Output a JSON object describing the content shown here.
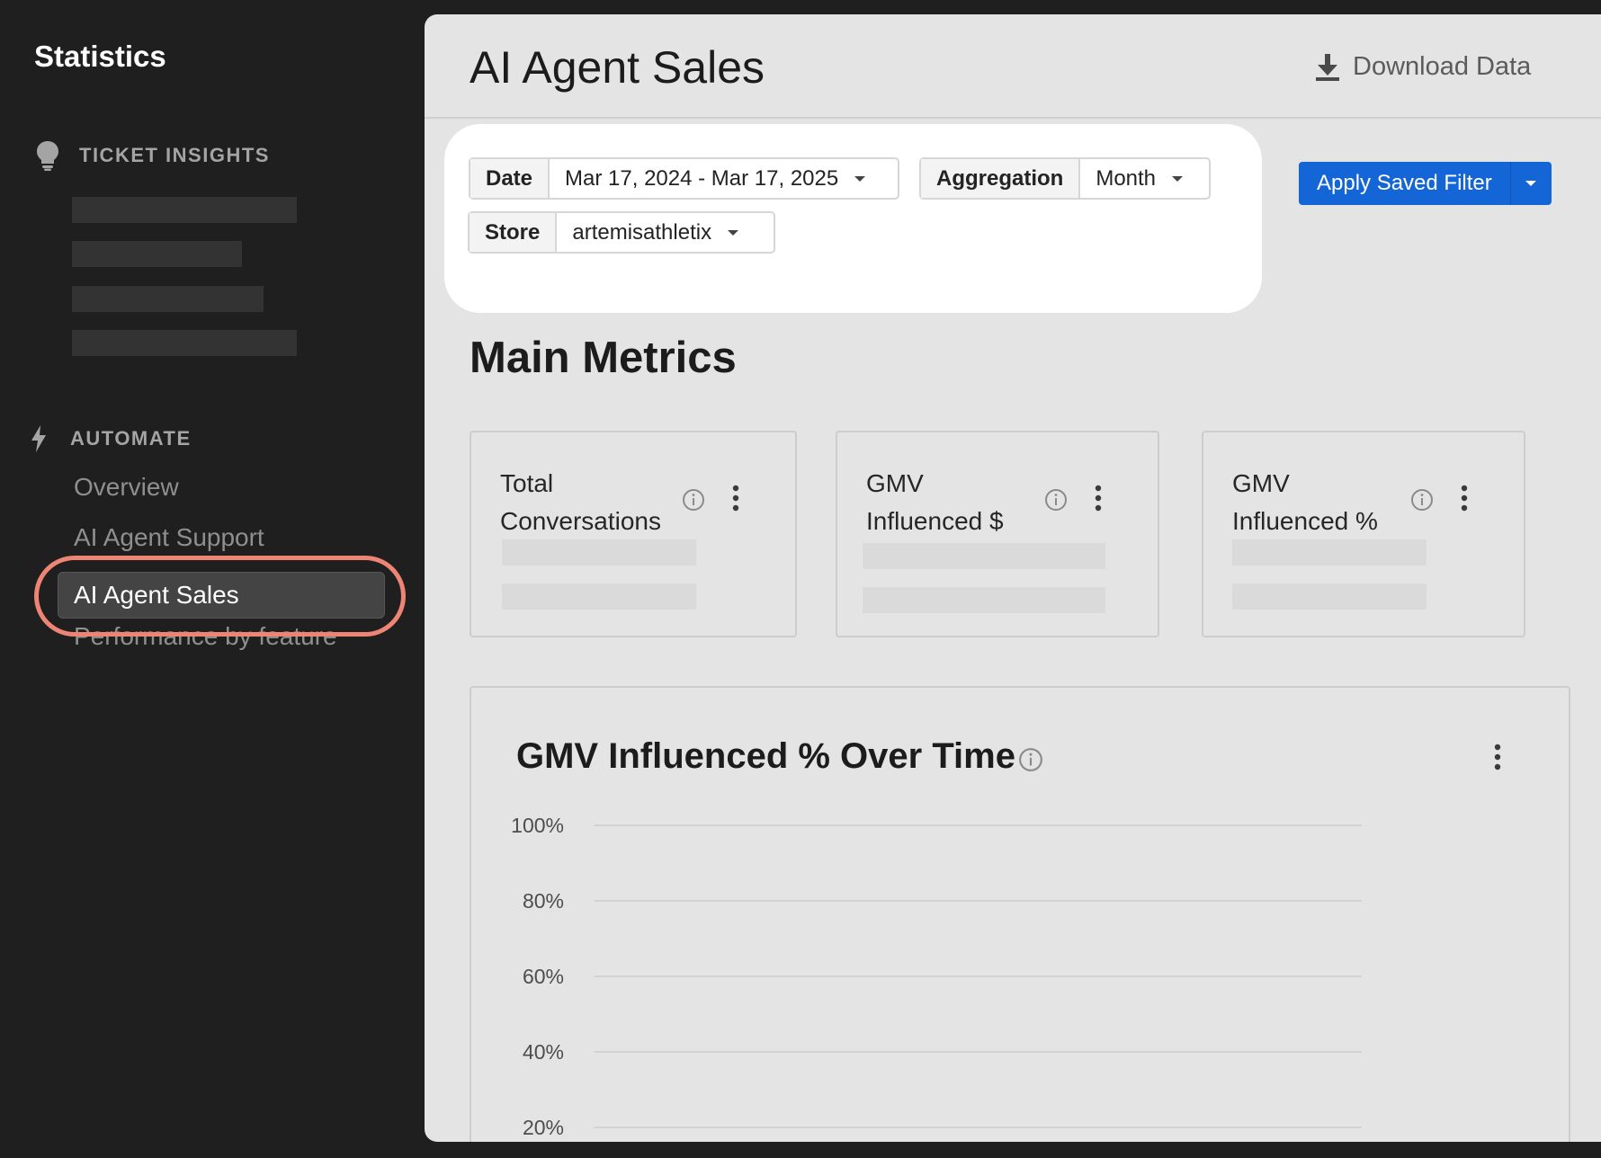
{
  "sidebar": {
    "title": "Statistics",
    "sections": {
      "ticket_insights": {
        "label": "TICKET INSIGHTS",
        "icon": "lightbulb-icon"
      },
      "automate": {
        "label": "AUTOMATE",
        "icon": "bolt-icon"
      }
    },
    "items": [
      {
        "label": "Overview"
      },
      {
        "label": "AI Agent Support"
      },
      {
        "label": "AI Agent Sales",
        "active": true
      },
      {
        "label": "Performance by feature"
      }
    ]
  },
  "header": {
    "title": "AI Agent Sales",
    "download_label": "Download Data",
    "download_icon": "download-icon"
  },
  "filters": {
    "date": {
      "label": "Date",
      "value": "Mar 17, 2024 - Mar 17, 2025"
    },
    "aggregation": {
      "label": "Aggregation",
      "value": "Month"
    },
    "store": {
      "label": "Store",
      "value": "artemisathletix"
    },
    "apply_label": "Apply Saved Filter"
  },
  "main_metrics": {
    "title": "Main Metrics",
    "cards": [
      {
        "title": "Total Conversations"
      },
      {
        "title": "GMV Influenced $"
      },
      {
        "title": "GMV Influenced %"
      }
    ]
  },
  "chart": {
    "title": "GMV Influenced % Over Time"
  },
  "chart_data": {
    "type": "line",
    "title": "GMV Influenced % Over Time",
    "y_ticks": [
      "100%",
      "80%",
      "60%",
      "40%",
      "20%"
    ],
    "ylim": [
      0,
      100
    ],
    "grid": true,
    "series": []
  },
  "colors": {
    "accent": "#1465d6",
    "highlight": "#ee8574",
    "sidebar_bg": "#1f1f1f",
    "panel_bg": "#e4e4e4"
  }
}
